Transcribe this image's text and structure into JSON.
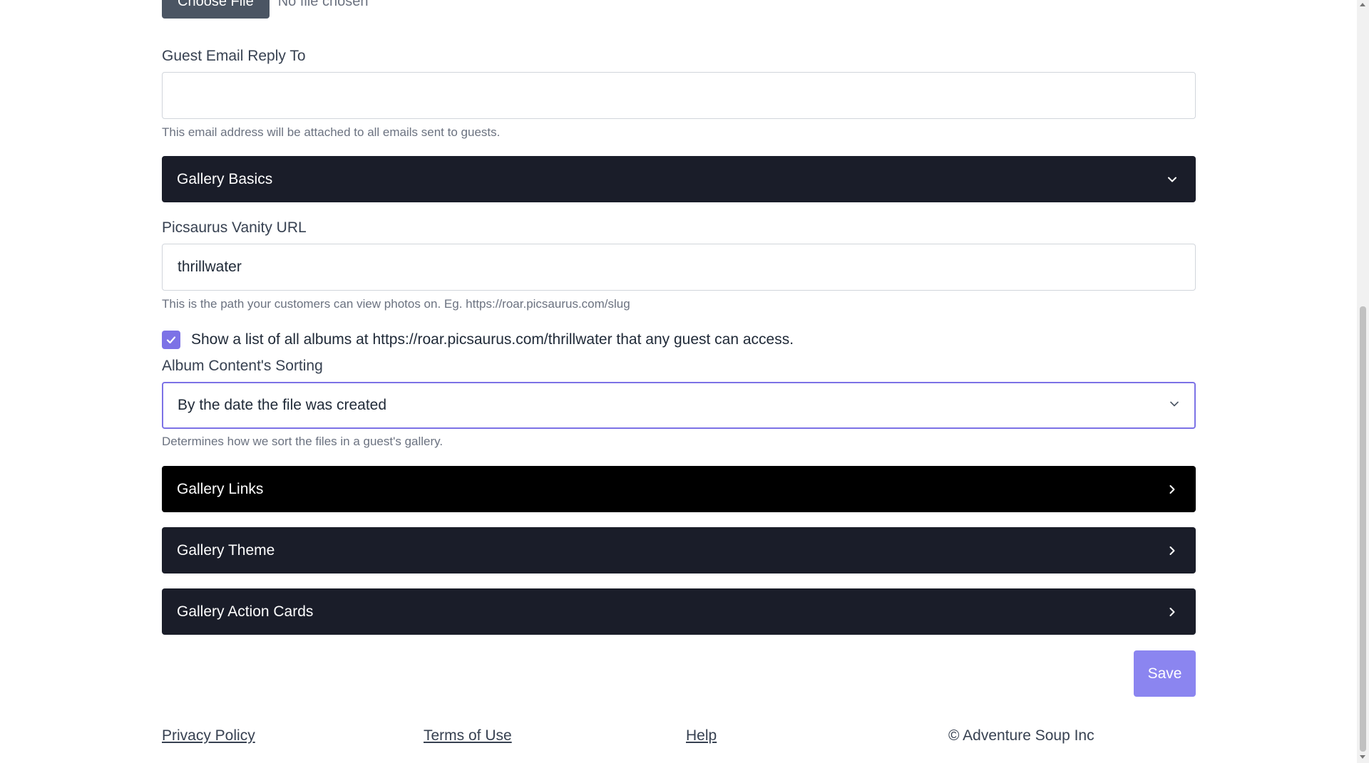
{
  "file_upload": {
    "button_label": "Choose File",
    "status": "No file chosen"
  },
  "guest_email": {
    "label": "Guest Email Reply To",
    "value": "",
    "help": "This email address will be attached to all emails sent to guests."
  },
  "sections": {
    "basics": "Gallery Basics",
    "links": "Gallery Links",
    "theme": "Gallery Theme",
    "action_cards": "Gallery Action Cards"
  },
  "vanity_url": {
    "label": "Picsaurus Vanity URL",
    "value": "thrillwater",
    "help": "This is the path your customers can view photos on. Eg. https://roar.picsaurus.com/slug"
  },
  "album_list_checkbox": {
    "checked": true,
    "label": "Show a list of all albums at https://roar.picsaurus.com/thrillwater that any guest can access."
  },
  "sorting": {
    "label": "Album Content's Sorting",
    "selected": "By the date the file was created",
    "help": "Determines how we sort the files in a guest's gallery."
  },
  "save_label": "Save",
  "footer": {
    "privacy": "Privacy Policy",
    "terms": "Terms of Use",
    "help": "Help",
    "copyright": "© Adventure Soup Inc"
  },
  "colors": {
    "accent": "#7c72e6",
    "save_button": "#8b85f0",
    "accordion": "#1a1d29"
  }
}
